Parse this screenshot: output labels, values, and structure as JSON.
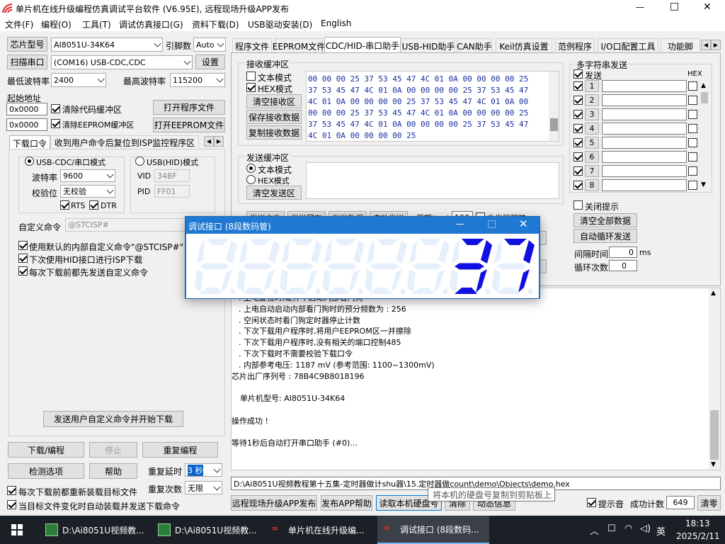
{
  "window": {
    "title": "单片机在线升级编程仿真调试平台软件 (V6.95E), 远程现场升级APP发布",
    "minimize": "—",
    "maximize": "□",
    "close": "✕"
  },
  "menu": [
    "文件(F)",
    "编程(O)",
    "工具(T)",
    "调试仿真接口(G)",
    "资料下载(D)",
    "USB驱动安装(D)",
    "English"
  ],
  "left": {
    "chip_type_btn": "芯片型号",
    "chip_model": "AI8051U-34K64",
    "pin_count_label": "引脚数",
    "pin_count": "Auto",
    "scan_port_btn": "扫描串口",
    "port": "(COM16) USB-CDC,CDC",
    "settings_btn": "设置",
    "min_baud_label": "最低波特率",
    "min_baud": "2400",
    "max_baud_label": "最高波特率",
    "max_baud": "115200",
    "start_addr_label": "起始地址",
    "code_addr": "0x0000",
    "clear_code": "清除代码缓冲区",
    "open_prog_btn": "打开程序文件",
    "eeprom_addr": "0x0000",
    "clear_eeprom": "清除EEPROM缓冲区",
    "open_eeprom_btn": "打开EEPROM文件",
    "tabs": [
      "下载口令",
      "收到用户命令后复位到ISP监控程序区"
    ],
    "usb_cdc_mode": "USB-CDC/串口模式",
    "usb_hid_mode": "USB(HID)模式",
    "baud_label": "波特率",
    "baud": "9600",
    "parity_label": "校验位",
    "parity": "无校验",
    "rts": "RTS",
    "dtr": "DTR",
    "vid_label": "VID",
    "vid": "34BF",
    "pid_label": "PID",
    "pid": "FF01",
    "custom_cmd_label": "自定义命令",
    "custom_cmd": "@STCISP#",
    "opt1": "使用默认的内部自定义命令\"@STCISP#\"",
    "opt2": "下次使用HID接口进行ISP下载",
    "opt3": "每次下载前都先发送自定义命令",
    "send_download_btn": "发送用户自定义命令并开始下载",
    "download_btn": "下载/编程",
    "stop_btn": "停止",
    "reprogram_btn": "重复编程",
    "detect_btn": "检测选项",
    "help_btn": "帮助",
    "repeat_delay_label": "重复延时",
    "repeat_delay": "3 秒",
    "repeat_count_label": "重复次数",
    "repeat_count": "无限",
    "reload_each": "每次下载前都重新装载目标文件",
    "auto_send": "当目标文件变化时自动装载并发送下载命令"
  },
  "right_tabs": [
    "程序文件",
    "EEPROM文件",
    "CDC/HID-串口助手",
    "USB-HID助手",
    "CAN助手",
    "Keil仿真设置",
    "范例程序",
    "I/O口配置工具",
    "功能脚"
  ],
  "serial": {
    "recv_title": "接收缓冲区",
    "text_mode": "文本模式",
    "hex_mode": "HEX模式",
    "clear_recv": "清空接收区",
    "save_recv": "保存接收数据",
    "copy_recv": "复制接收数据",
    "recv_lines": [
      "00 00 00 25 37 53 45 47 4C 01 0A 00 00 00 00 25",
      "37 53 45 47 4C 01 0A 00 00 00 00 25 37 53 45 47",
      "4C 01 0A 00 00 00 00 25 37 53 45 47 4C 01 0A 00",
      "00 00 00 25 37 53 45 47 4C 01 0A 00 00 00 00 25",
      "37 53 45 47 4C 01 0A 00 00 00 00 25 37 53 45 47",
      "4C 01 0A 00 00 00 00 25"
    ],
    "send_title": "发送缓冲区",
    "send_text_mode": "文本模式",
    "send_hex_mode": "HEX模式",
    "clear_send": "清空发送区",
    "hidden_row": [
      "发送文件",
      "发送回车",
      "发送数据",
      "自动发送",
      "周期(ms)",
      "100",
      "收发区翻转"
    ],
    "multi_title": "多字符串发送",
    "send_col": "发送",
    "hex_col": "HEX",
    "rows": [
      "1",
      "2",
      "3",
      "4",
      "5",
      "6",
      "7",
      "8"
    ],
    "close_hint": "关闭提示",
    "clear_all": "清空全部数据",
    "auto_loop": "自动循环发送",
    "interval_label": "间隔时间",
    "interval": "0",
    "interval_unit": "ms",
    "loop_count_label": "循环次数",
    "loop_count": "0"
  },
  "log": [
    ". 上电复位时,硬件不启动内部看门狗",
    ". 上电自动启动内部看门狗时的预分频数为 : 256",
    ". 空闲状态时看门狗定时器停止计数",
    ". 下次下载用户程序时,将用户EEPROM区一并擦除",
    ". 下次下载用户程序时,没有相关的端口控制485",
    ". 下次下载时不需要校验下载口令",
    ". 内部参考电压: 1187 mV (参考范围: 1100~1300mV)",
    "芯片出厂序列号 : 78B4C9B8018196",
    "",
    "单片机型号: AI8051U-34K64",
    "",
    "操作成功 !",
    "",
    "等待1秒后自动打开串口助手 (#0)..."
  ],
  "path": "D:\\Ai8051U视频教程第十五集-定时器做计shu器\\15.定时器做count\\demo\\Objects\\demo.hex",
  "bottom": {
    "remote_app": "远程现场升级APP发布",
    "publish_help": "发布APP帮助",
    "read_disk": "读取本机硬盘号",
    "clear": "清除",
    "dynamic_info": "动态信息",
    "tooltip": "将本机的硬盘号复制到剪贴板上",
    "prompt_sound": "提示音",
    "success_count_label": "成功计数",
    "success_count": "649",
    "clear_count": "清零"
  },
  "seg_window": {
    "title": "调试接口 (8段数码管)",
    "digits": [
      "",
      "",
      "",
      "",
      "",
      "",
      "3",
      "7"
    ],
    "color": "#1010e0"
  },
  "taskbar": {
    "items": [
      "D:\\Ai8051U视频教...",
      "D:\\Ai8051U视频教...",
      "单片机在线升级编...",
      "调试接口 (8段数码..."
    ],
    "ime": "英",
    "time": "18:13",
    "date": "2025/2/11"
  }
}
